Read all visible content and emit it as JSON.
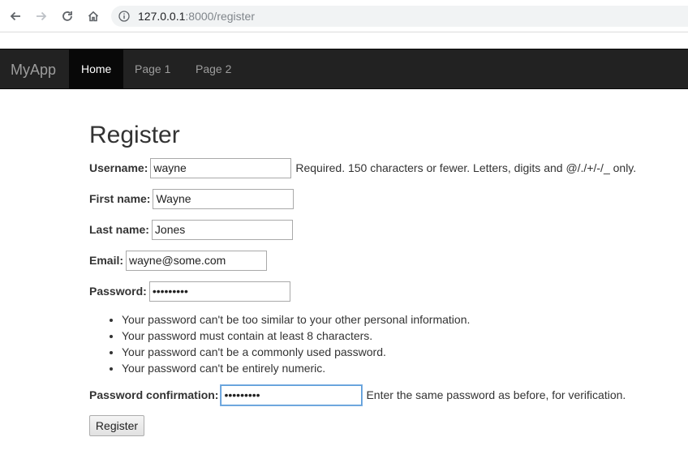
{
  "browser": {
    "url_host": "127.0.0.1",
    "url_path": ":8000/register"
  },
  "navbar": {
    "brand": "MyApp",
    "items": [
      {
        "label": "Home",
        "active": true
      },
      {
        "label": "Page 1",
        "active": false
      },
      {
        "label": "Page 2",
        "active": false
      }
    ]
  },
  "form": {
    "title": "Register",
    "username": {
      "label": "Username:",
      "value": "wayne",
      "help": "Required. 150 characters or fewer. Letters, digits and @/./+/-/_ only."
    },
    "first_name": {
      "label": "First name:",
      "value": "Wayne"
    },
    "last_name": {
      "label": "Last name:",
      "value": "Jones"
    },
    "email": {
      "label": "Email:",
      "value": "wayne@some.com"
    },
    "password": {
      "label": "Password:",
      "value": "12345678a"
    },
    "password_rules": [
      "Your password can't be too similar to your other personal information.",
      "Your password must contain at least 8 characters.",
      "Your password can't be a commonly used password.",
      "Your password can't be entirely numeric."
    ],
    "password_confirmation": {
      "label": "Password confirmation:",
      "value": "12345678a",
      "help": "Enter the same password as before, for verification."
    },
    "submit_label": "Register"
  },
  "colors": {
    "navbar_bg": "#222222",
    "navbar_active_bg": "#080808",
    "navbar_text": "#9d9d9d"
  }
}
